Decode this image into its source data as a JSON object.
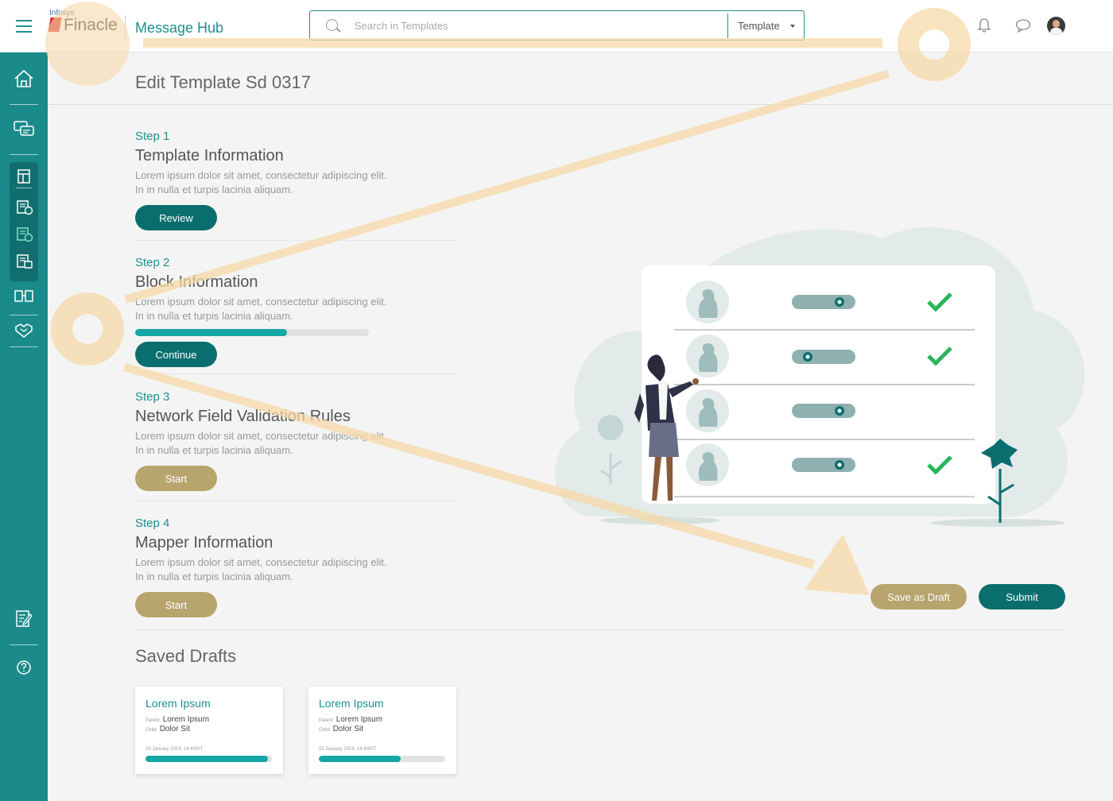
{
  "header": {
    "brand_small": "Infosys",
    "brand": "Finacle",
    "app_title": "Message Hub",
    "search_placeholder": "Search in Templates",
    "search_scope": "Template"
  },
  "sidebar": {
    "items": [
      "home-icon",
      "messages-icon",
      "template-icon",
      "block-icon",
      "network-rules-icon",
      "mapper-icon",
      "compare-icon",
      "handshake-icon",
      "edit-note-icon",
      "help-icon"
    ]
  },
  "page": {
    "title": "Edit Template Sd 0317"
  },
  "steps": [
    {
      "num": "Step 1",
      "name": "Template Information",
      "desc1": "Lorem ipsum dolor sit amet, consectetur adipiscing elit.",
      "desc2": "In in nulla et turpis lacinia aliquam.",
      "button": "Review"
    },
    {
      "num": "Step 2",
      "name": "Block Information",
      "desc1": "Lorem ipsum dolor sit amet, consectetur adipiscing elit.",
      "desc2": "In in nulla et turpis lacinia aliquam.",
      "button": "Continue",
      "progress": 0.65
    },
    {
      "num": "Step 3",
      "name": "Network Field Validation Rules",
      "desc1": "Lorem ipsum dolor sit amet, consectetur adipiscing elit.",
      "desc2": "In in nulla et turpis lacinia aliquam.",
      "button": "Start"
    },
    {
      "num": "Step 4",
      "name": "Mapper Information",
      "desc1": "Lorem ipsum dolor sit amet, consectetur adipiscing elit.",
      "desc2": "In in nulla et turpis lacinia aliquam.",
      "button": "Start"
    }
  ],
  "actions": {
    "draft": "Save as Draft",
    "submit": "Submit"
  },
  "drafts": {
    "title": "Saved Drafts",
    "cards": [
      {
        "title": "Lorem Ipsum",
        "parent_label": "Parent",
        "parent": "Lorem Ipsum",
        "child_label": "Child",
        "child": "Dolor Sit",
        "timestamp": "23 January 2019, 14:40IST",
        "progress": 0.97
      },
      {
        "title": "Lorem Ipsum",
        "parent_label": "Parent",
        "parent": "Lorem Ipsum",
        "child_label": "Child",
        "child": "Dolor Sit",
        "timestamp": "23 January 2019, 14:40IST",
        "progress": 0.65
      }
    ]
  },
  "colors": {
    "primary": "#1a8a8a",
    "primary_dark": "#0b6e6e",
    "accent_gold": "#b8a46d",
    "progress": "#15a6a6",
    "check": "#2bb55a",
    "annotation": "#f5d9a8"
  }
}
